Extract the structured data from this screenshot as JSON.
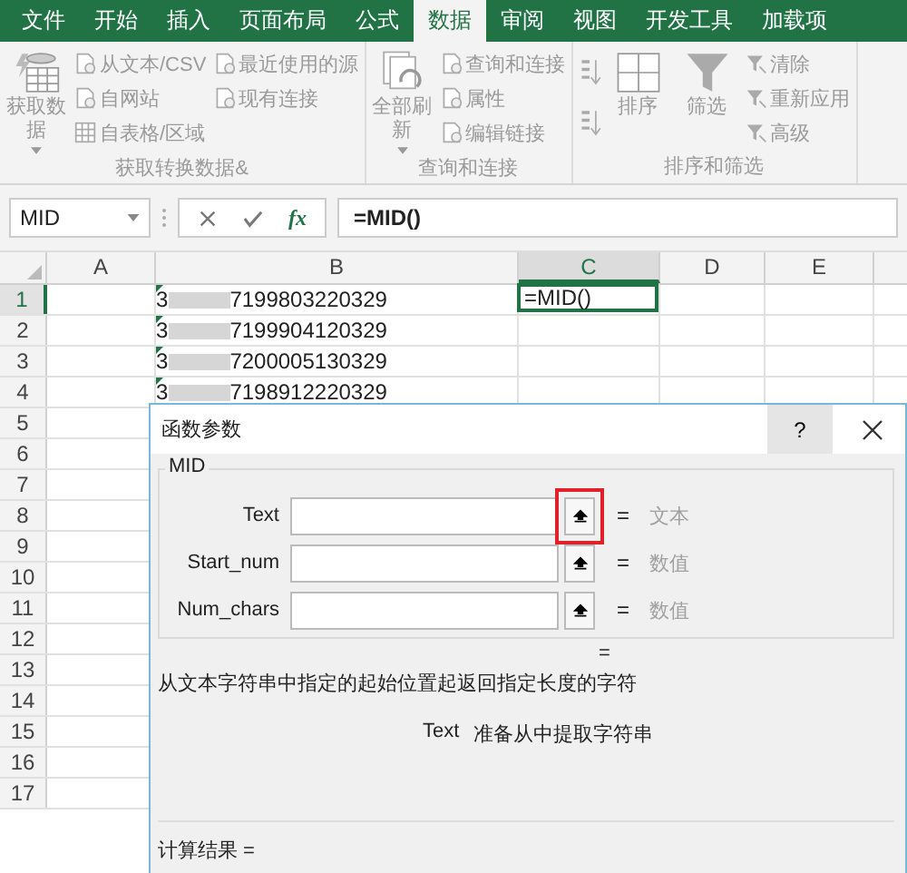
{
  "ribbon": {
    "disabled": true,
    "tabs": [
      {
        "label": "文件",
        "selected": false
      },
      {
        "label": "开始",
        "selected": false
      },
      {
        "label": "插入",
        "selected": false
      },
      {
        "label": "页面布局",
        "selected": false
      },
      {
        "label": "公式",
        "selected": false
      },
      {
        "label": "数据",
        "selected": true
      },
      {
        "label": "审阅",
        "selected": false
      },
      {
        "label": "视图",
        "selected": false
      },
      {
        "label": "开发工具",
        "selected": false
      },
      {
        "label": "加载项",
        "selected": false
      }
    ],
    "groups": [
      {
        "label": "获取转换数据&",
        "items": [
          {
            "kind": "big",
            "label": "获取数据",
            "dropdown": true
          },
          {
            "kind": "column",
            "items": [
              {
                "label": "从文本/CSV"
              },
              {
                "label": "自网站"
              },
              {
                "label": "自表格/区域"
              }
            ]
          },
          {
            "kind": "column",
            "items": [
              {
                "label": "最近使用的源"
              },
              {
                "label": "现有连接"
              }
            ]
          }
        ]
      },
      {
        "label": "查询和连接",
        "items": [
          {
            "kind": "big",
            "label": "全部刷新",
            "dropdown": true
          },
          {
            "kind": "column",
            "items": [
              {
                "label": "查询和连接"
              },
              {
                "label": "属性"
              },
              {
                "label": "编辑链接"
              }
            ]
          }
        ]
      },
      {
        "label": "排序和筛选",
        "items": [
          {
            "kind": "icons"
          },
          {
            "kind": "big",
            "label": "排序"
          },
          {
            "kind": "big",
            "label": "筛选"
          },
          {
            "kind": "column",
            "items": [
              {
                "label": "清除"
              },
              {
                "label": "重新应用"
              },
              {
                "label": "高级"
              }
            ]
          }
        ]
      }
    ]
  },
  "formula_bar": {
    "name_box": "MID",
    "formula": "=MID()",
    "fx": "fx"
  },
  "sheet": {
    "columns": [
      {
        "label": "A",
        "selected": false
      },
      {
        "label": "B",
        "selected": false
      },
      {
        "label": "C",
        "selected": true
      },
      {
        "label": "D",
        "selected": false
      },
      {
        "label": "E",
        "selected": false
      }
    ],
    "rows": [
      {
        "number": "1",
        "selected": true,
        "b": {
          "prefix": "3",
          "suffix": "7199803220329"
        },
        "c": {
          "text": "=MID()",
          "selected": true
        }
      },
      {
        "number": "2",
        "selected": false,
        "b": {
          "prefix": "3",
          "suffix": "7199904120329"
        }
      },
      {
        "number": "3",
        "selected": false,
        "b": {
          "prefix": "3",
          "suffix": "7200005130329"
        }
      },
      {
        "number": "4",
        "selected": false,
        "b": {
          "prefix": "3",
          "suffix": "7198912220329"
        }
      },
      {
        "number": "5",
        "selected": false
      },
      {
        "number": "6",
        "selected": false
      },
      {
        "number": "7",
        "selected": false
      },
      {
        "number": "8",
        "selected": false
      },
      {
        "number": "9",
        "selected": false
      },
      {
        "number": "10",
        "selected": false
      },
      {
        "number": "11",
        "selected": false
      },
      {
        "number": "12",
        "selected": false
      },
      {
        "number": "13",
        "selected": false
      },
      {
        "number": "14",
        "selected": false
      },
      {
        "number": "15",
        "selected": false
      },
      {
        "number": "16",
        "selected": false
      },
      {
        "number": "17",
        "selected": false
      }
    ]
  },
  "dialog": {
    "title": "函数参数",
    "help": "?",
    "function": "MID",
    "args": [
      {
        "label": "Text",
        "equals": "=",
        "hint": "文本",
        "highlighted": true
      },
      {
        "label": "Start_num",
        "equals": "=",
        "hint": "数值",
        "highlighted": false
      },
      {
        "label": "Num_chars",
        "equals": "=",
        "hint": "数值",
        "highlighted": false
      }
    ],
    "result_equals": "=",
    "description": "从文本字符串中指定的起始位置起返回指定长度的字符",
    "arg_help_name": "Text",
    "arg_help": "准备从中提取字符串",
    "result_label": "计算结果 ="
  }
}
